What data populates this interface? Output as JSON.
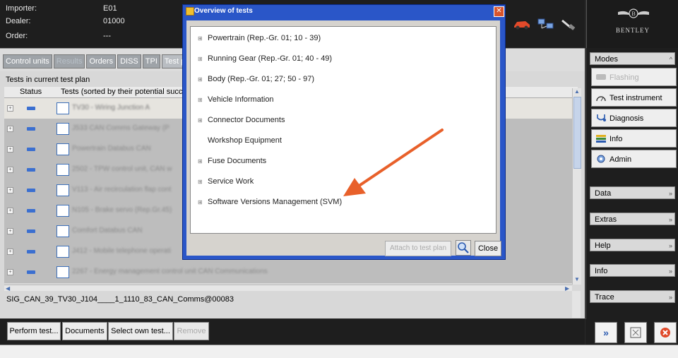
{
  "header": {
    "importer_label": "Importer:",
    "importer_value": "E01",
    "dealer_label": "Dealer:",
    "dealer_value": "01000",
    "order_label": "Order:",
    "order_value": "---",
    "brand": "BENTLEY"
  },
  "tabs": [
    "Control units",
    "Results",
    "Orders",
    "DISS",
    "TPI",
    "Test pl"
  ],
  "panel": {
    "title": "Tests in current test plan",
    "col_status": "Status",
    "col_tests": "Tests (sorted by their potential succ",
    "rows": [
      "TV30 - Wiring Junction A",
      "J533 CAN Comms Gateway (P",
      "Powertrain Databus CAN",
      "2502 - TPW control unit, CAN w",
      "V113 - Air recirculation flap cont",
      "N105 - Brake servo (Rep.Gr.45)",
      "Comfort Databus CAN",
      "J412 - Mobile telephone operati",
      "2267 - Energy management control unit CAN Communications"
    ],
    "info_text": "SIG_CAN_39_TV30_J104____1_1110_83_CAN_Comms@00083"
  },
  "buttons": {
    "perform": "Perform test...",
    "documents": "Documents",
    "select_own": "Select own test...",
    "remove": "Remove"
  },
  "sidebar": {
    "modes": "Modes",
    "flashing": "Flashing",
    "test_instrument": "Test instrument",
    "diagnosis": "Diagnosis",
    "info": "Info",
    "admin": "Admin",
    "data": "Data",
    "extras": "Extras",
    "help": "Help",
    "info_section": "Info",
    "trace": "Trace"
  },
  "dialog": {
    "title": "Overview of tests",
    "items": [
      "Powertrain (Rep.-Gr. 01; 10 - 39)",
      "Running Gear (Rep.-Gr. 01; 40 - 49)",
      "Body (Rep.-Gr. 01; 27; 50 - 97)",
      "Vehicle Information",
      "Connector Documents",
      "Workshop Equipment",
      "Fuse Documents",
      "Service Work",
      "Software Versions Management (SVM)"
    ],
    "attach": "Attach to test plan",
    "close": "Close"
  },
  "colors": {
    "arrow": "#e8602a",
    "dialog_title": "#2a56c8"
  }
}
